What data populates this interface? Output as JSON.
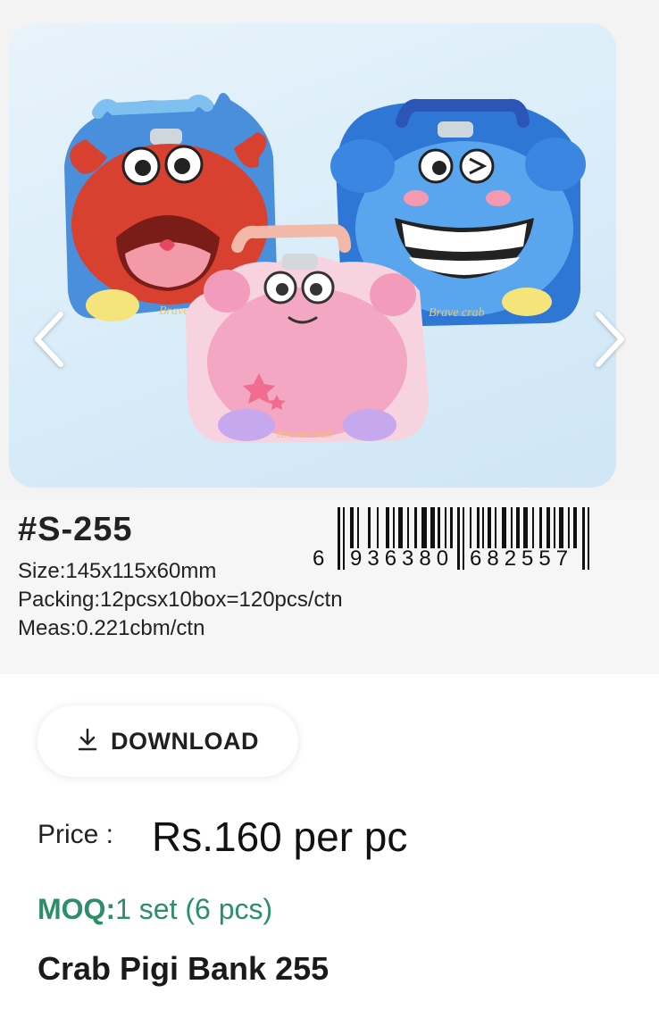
{
  "carousel": {
    "image_alt": "Crab coin banks: red, blue and pink crab tins",
    "tin_text": "Brave crab",
    "prev_icon": "chevron-left-icon",
    "next_icon": "chevron-right-icon"
  },
  "product_sheet": {
    "model": "#S-255",
    "size": "Size:145x115x60mm",
    "packing": "Packing:12pcsx10box=120pcs/ctn",
    "meas": "Meas:0.221cbm/ctn",
    "barcode": {
      "first_digit": "6",
      "group_left": "936380",
      "group_right": "682557"
    }
  },
  "actions": {
    "download_label": "DOWNLOAD",
    "download_icon": "download-icon"
  },
  "pricing": {
    "price_label": "Price :",
    "price_value": "Rs.160 per pc",
    "moq_label": "MOQ:",
    "moq_value": "1 set (6 pcs)"
  },
  "product": {
    "title": "Crab Pigi Bank 255"
  },
  "colors": {
    "moq_green": "#2c8f67",
    "crab_red": "#d8412f",
    "crab_blue": "#3f8fe0",
    "crab_pink": "#f6b7cc"
  }
}
